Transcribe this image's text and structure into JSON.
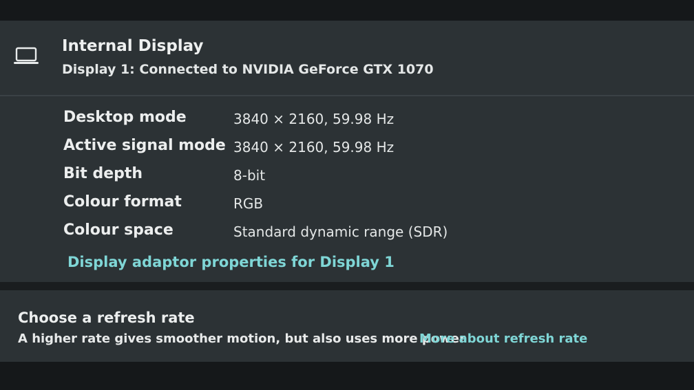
{
  "header": {
    "title": "Internal Display",
    "subtitle": "Display 1: Connected to NVIDIA GeForce GTX 1070",
    "icon": "laptop-icon"
  },
  "properties": [
    {
      "label": "Desktop mode",
      "value": "3840 × 2160, 59.98 Hz"
    },
    {
      "label": "Active signal mode",
      "value": "3840 × 2160, 59.98 Hz"
    },
    {
      "label": "Bit depth",
      "value": "8-bit"
    },
    {
      "label": "Colour format",
      "value": "RGB"
    },
    {
      "label": "Colour space",
      "value": "Standard dynamic range (SDR)"
    }
  ],
  "adaptor_link": "Display adaptor properties for Display 1",
  "refresh": {
    "title": "Choose a refresh rate",
    "description": "A higher rate gives smoother motion, but also uses more power",
    "link": "More about refresh rate"
  },
  "colors": {
    "card_bg": "#2c3235",
    "page_bg": "#1a1d1f",
    "link": "#7fd6d6",
    "text": "#eceeee"
  }
}
